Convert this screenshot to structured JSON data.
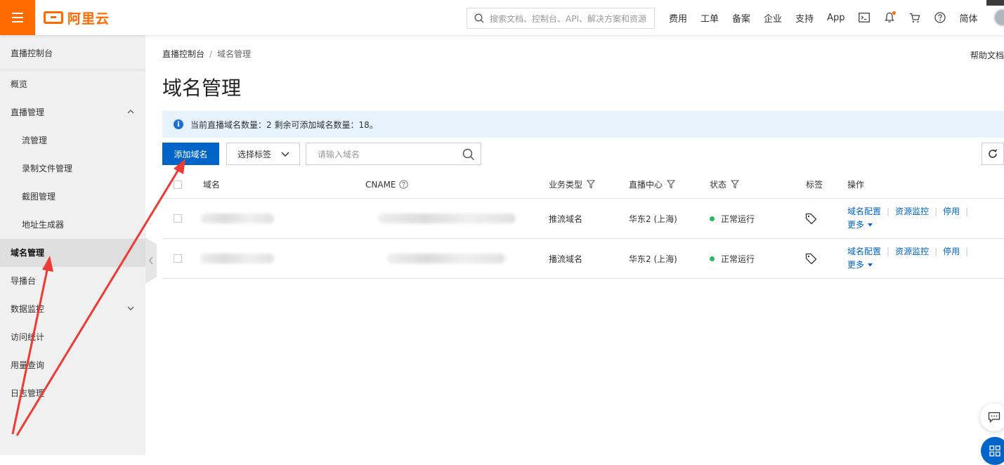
{
  "header": {
    "logo_text": "阿里云",
    "search_placeholder": "搜索文档、控制台、API、解决方案和资源",
    "nav": [
      "费用",
      "工单",
      "备案",
      "企业",
      "支持",
      "App"
    ],
    "language": "简体",
    "brand_color": "#ff6a00"
  },
  "sidebar": {
    "title": "直播控制台",
    "items": [
      {
        "label": "概览"
      },
      {
        "label": "直播管理"
      },
      {
        "label": "流管理"
      },
      {
        "label": "录制文件管理"
      },
      {
        "label": "截图管理"
      },
      {
        "label": "地址生成器"
      },
      {
        "label": "域名管理"
      },
      {
        "label": "导播台"
      },
      {
        "label": "数据监控"
      },
      {
        "label": "访问统计"
      },
      {
        "label": "用量查询"
      },
      {
        "label": "日志管理"
      }
    ]
  },
  "main": {
    "breadcrumb": {
      "root": "直播控制台",
      "separator": "/",
      "current": "域名管理"
    },
    "help_link": "帮助文档",
    "title": "域名管理",
    "notice": "当前直播域名数量：2 剩余可添加域名数量：18。",
    "toolbar": {
      "add_button": "添加域名",
      "tag_select": "选择标签",
      "domain_input_placeholder": "请输入域名"
    },
    "table": {
      "columns": {
        "domain": "域名",
        "cname": "CNAME",
        "business_type": "业务类型",
        "region": "直播中心",
        "status": "状态",
        "tags": "标签",
        "actions": "操作"
      },
      "rows": [
        {
          "business_type": "推流域名",
          "region": "华东2 (上海)",
          "status": "正常运行"
        },
        {
          "business_type": "播流域名",
          "region": "华东2 (上海)",
          "status": "正常运行"
        }
      ],
      "row_actions": {
        "config": "域名配置",
        "monitor": "资源监控",
        "disable": "停用",
        "more": "更多"
      }
    }
  },
  "colors": {
    "primary": "#0064c8",
    "status_ok": "#1fbf59",
    "annotation_arrow": "#ee3a35"
  }
}
